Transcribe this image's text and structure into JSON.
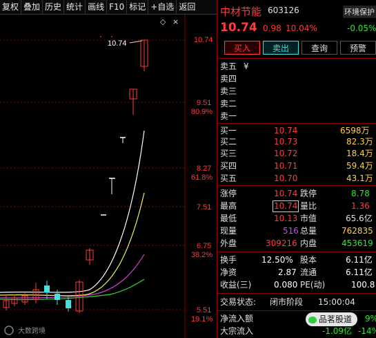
{
  "toolbar": {
    "items": [
      "复权",
      "叠加",
      "历史",
      "统计",
      "画线",
      "F10",
      "标记",
      "+自选",
      "返回"
    ]
  },
  "chart": {
    "price_axis": [
      "10.74",
      "9.51",
      "80.9%",
      "8.27",
      "61.8%",
      "7.51",
      "6.75",
      "38.2%",
      "5.51",
      "19.1%"
    ],
    "high_label": "10.74",
    "watermark": "大数跨境"
  },
  "stock": {
    "name": "中材节能",
    "code": "603126",
    "sector": "环境保护",
    "sector_change": "-0.05%",
    "price": "10.74",
    "change": "0.98",
    "change_pct": "10.04%"
  },
  "actions": {
    "buy": "买入",
    "sell": "卖出",
    "query": "查询",
    "alert": "预警"
  },
  "orderbook": {
    "sell": [
      {
        "label": "卖五",
        "extra": "¥"
      },
      {
        "label": "卖四"
      },
      {
        "label": "卖三"
      },
      {
        "label": "卖二"
      },
      {
        "label": "卖一"
      }
    ],
    "buy": [
      {
        "label": "买一",
        "price": "10.74",
        "volume": "6598万"
      },
      {
        "label": "买二",
        "price": "10.73",
        "volume": "82.3万"
      },
      {
        "label": "买三",
        "price": "10.72",
        "volume": "18.4万"
      },
      {
        "label": "买四",
        "price": "10.71",
        "volume": "59.4万"
      },
      {
        "label": "买五",
        "price": "10.70",
        "volume": "43.1万"
      }
    ]
  },
  "stats": {
    "limit_up_label": "涨停",
    "limit_up": "10.74",
    "limit_down_label": "跌停",
    "limit_down": "8.78",
    "high_label": "最高",
    "high": "10.74",
    "vol_ratio_label": "量比",
    "vol_ratio": "1.36",
    "low_label": "最低",
    "low": "10.13",
    "mkt_cap_label": "市值",
    "mkt_cap": "65.6亿",
    "cur_vol_label": "现量",
    "cur_vol": "516",
    "total_vol_label": "总量",
    "total_vol": "762835",
    "outer_label": "外盘",
    "outer": "309216",
    "inner_label": "内盘",
    "inner": "453619",
    "turnover_label": "换手",
    "turnover": "12.50%",
    "capital_label": "股本",
    "capital": "6.11亿",
    "nav_label": "净资",
    "nav": "2.87",
    "float_label": "流通",
    "float_val": "6.11亿",
    "eps_label": "收益(三)",
    "eps": "0.080",
    "pe_label": "PE(动)",
    "pe": "100.8"
  },
  "status": {
    "label": "交易状态:",
    "value": "闭市阶段",
    "time": "15:00:04"
  },
  "flow": {
    "net_label": "净流入额",
    "net_value": "9%",
    "block_label": "大宗流入",
    "block_value": "-1.09亿",
    "block_pct": "-14%",
    "brand": "品茗股道"
  }
}
